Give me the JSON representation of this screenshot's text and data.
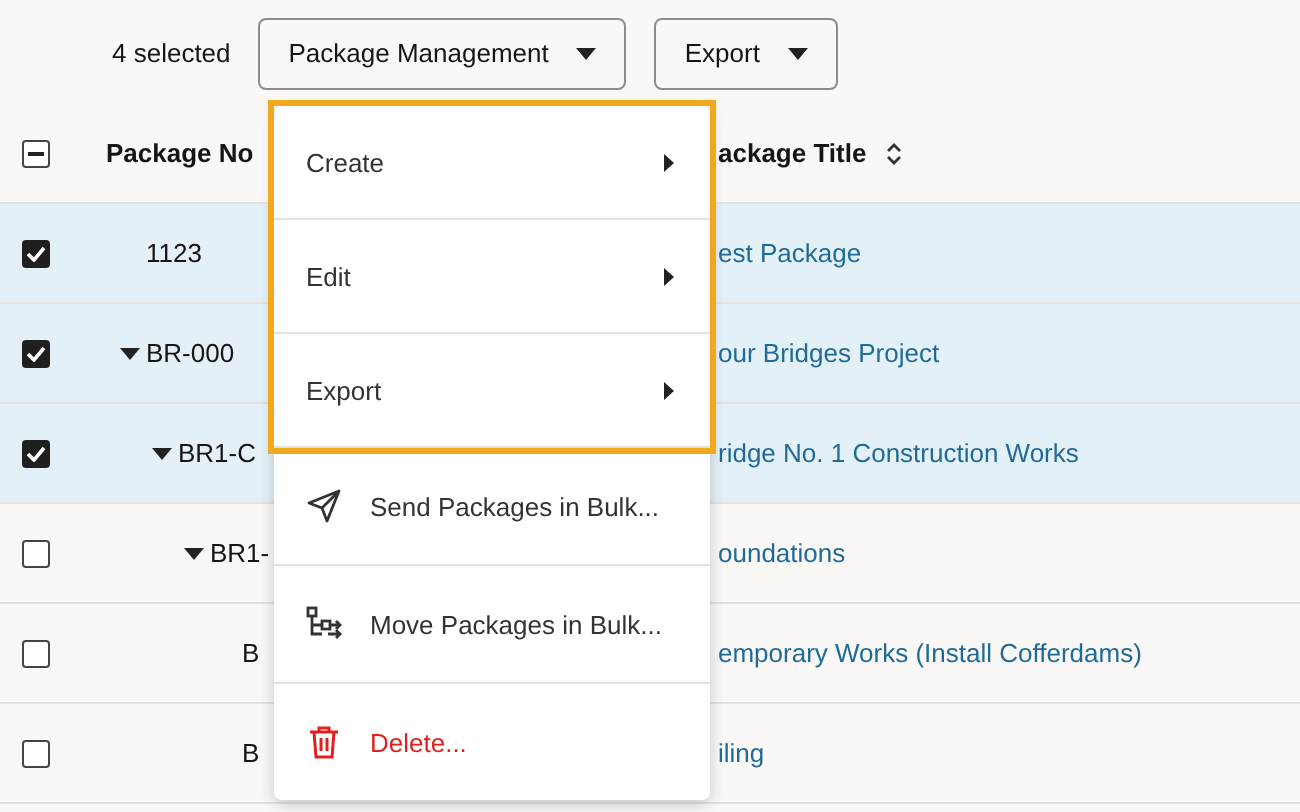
{
  "toolbar": {
    "selection_count": "4 selected",
    "buttons": [
      {
        "label": "Package Management"
      },
      {
        "label": "Export"
      }
    ]
  },
  "table": {
    "select_all": {
      "partial": true
    },
    "columns": [
      {
        "label": "Package No"
      },
      {
        "label": "ackage Title",
        "sortable": true
      }
    ],
    "rows": [
      {
        "package_no": "1123",
        "title": "est Package",
        "selected": true
      },
      {
        "package_no": "BR-000",
        "title": "our Bridges Project",
        "selected": true,
        "expanded": true,
        "children": [
          {
            "package_no": "BR1-C",
            "title": "ridge No. 1 Construction Works",
            "selected": true,
            "expanded": true,
            "children": [
              {
                "package_no": "BR1-",
                "title": "oundations",
                "selected": false,
                "expanded": true,
                "children": [
                  {
                    "package_no": "B",
                    "title": "emporary Works (Install Cofferdams)",
                    "selected": false
                  },
                  {
                    "package_no": "B",
                    "title": "iling",
                    "selected": false
                  }
                ]
              }
            ]
          }
        ]
      }
    ]
  },
  "menu": {
    "groups": [
      {
        "focused": true,
        "items": [
          {
            "kind": "submenu",
            "label": "Create"
          },
          {
            "kind": "submenu",
            "label": "Edit"
          },
          {
            "kind": "submenu",
            "label": "Export"
          }
        ]
      },
      {
        "items": [
          {
            "kind": "send",
            "label": "Send Packages in Bulk..."
          },
          {
            "kind": "move",
            "label": "Move Packages in Bulk..."
          },
          {
            "kind": "delete",
            "label": "Delete..."
          }
        ]
      }
    ]
  }
}
